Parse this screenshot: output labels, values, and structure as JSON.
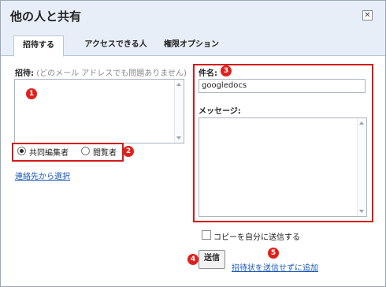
{
  "dialog": {
    "title": "他の人と共有",
    "close_label": "✕"
  },
  "tabs": [
    {
      "label": "招待する",
      "active": true
    },
    {
      "label": "アクセスできる人",
      "active": false
    },
    {
      "label": "権限オプション",
      "active": false
    }
  ],
  "invite": {
    "label": "招待:",
    "hint": "(どのメール アドレスでも問題ありません)",
    "value": "",
    "role_options": [
      {
        "label": "共同編集者",
        "selected": true
      },
      {
        "label": "閲覧者",
        "selected": false
      }
    ],
    "contacts_link": "連絡先から選択"
  },
  "message": {
    "subject_label": "件名:",
    "subject_value": "googledocs",
    "body_label": "メッセージ:",
    "body_value": ""
  },
  "copy_to_self": {
    "label": "コピーを自分に送信する",
    "checked": false
  },
  "actions": {
    "send_label": "送信",
    "add_without_invite_label": "招待状を送信せずに追加"
  },
  "callouts": [
    "1",
    "2",
    "3",
    "4",
    "5"
  ],
  "colors": {
    "callout_red": "#d31b1b",
    "link_blue": "#1a57b6",
    "header_bg": "#e8eef7"
  }
}
